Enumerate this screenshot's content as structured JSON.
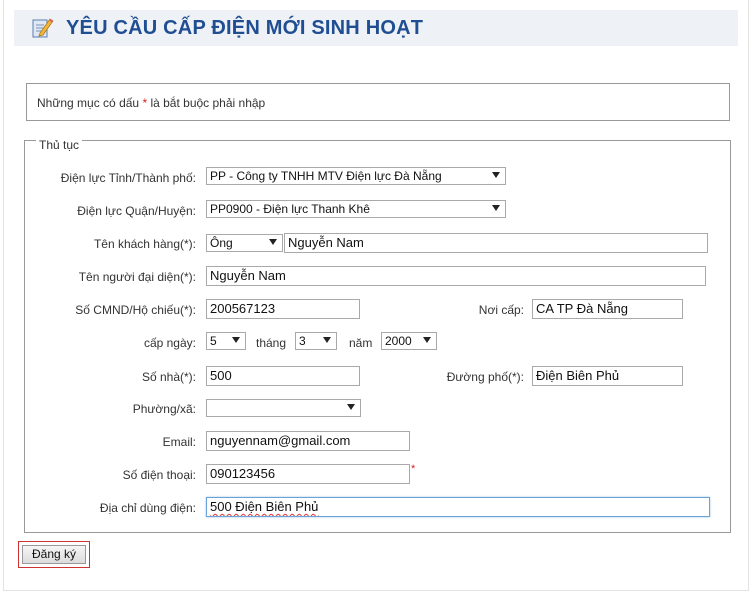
{
  "page": {
    "title": "YÊU CẦU CẤP ĐIỆN MỚI SINH HOẠT",
    "notice_prefix": "Những mục có dấu",
    "notice_star": "*",
    "notice_suffix": "là bắt buộc phải nhập"
  },
  "form": {
    "legend": "Thủ tục",
    "dien_luc_tinh": {
      "label": "Điện lực Tỉnh/Thành phố:",
      "value": "PP - Công ty TNHH MTV Điện lực Đà Nẵng"
    },
    "dien_luc_quan": {
      "label": "Điện lực Quận/Huyện:",
      "value": "PP0900 - Điện lực Thanh Khê"
    },
    "ten_khach_hang": {
      "label": "Tên khách hàng(*):",
      "title_value": "Ông",
      "value": "Nguyễn Nam"
    },
    "ten_dai_dien": {
      "label": "Tên người đại diện(*):",
      "value": "Nguyễn Nam"
    },
    "cmnd": {
      "label": "Số CMND/Hộ chiếu(*):",
      "value": "200567123"
    },
    "noi_cap": {
      "label": "Nơi cấp:",
      "value": "CA TP Đà Nẵng"
    },
    "cap_ngay": {
      "label": "cấp ngày:",
      "day": "5",
      "month_label": "tháng",
      "month": "3",
      "year_label": "năm",
      "year": "2000"
    },
    "so_nha": {
      "label": "Số nhà(*):",
      "value": "500"
    },
    "duong_pho": {
      "label": "Đường phố(*):",
      "value": "Điện Biên Phủ"
    },
    "phuong_xa": {
      "label": "Phường/xã:",
      "value": ""
    },
    "email": {
      "label": "Email:",
      "value": "nguyennam@gmail.com"
    },
    "so_dien_thoai": {
      "label": "Số điện thoại:",
      "value": "090123456",
      "required_mark": "*"
    },
    "dia_chi": {
      "label": "Địa chỉ dùng điện:",
      "value": "500 Điện Biên Phủ"
    }
  },
  "actions": {
    "submit_label": "Đăng ký"
  },
  "colors": {
    "title": "#1f4e93",
    "header_bg": "#eef1f6",
    "required": "#dd2222",
    "focus_border": "#6aa3d8"
  },
  "icons": {
    "header": "form-edit-icon",
    "select": "chevron-down-icon"
  }
}
